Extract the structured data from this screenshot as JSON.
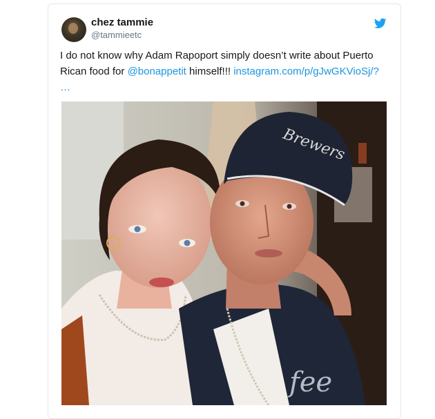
{
  "tweet": {
    "display_name": "chez tammie",
    "handle": "@tammieetc",
    "text_part1": "I do not know why Adam Rapoport simply doesn’t write about Puerto Rican food for ",
    "mention": "@bonappetit",
    "text_part2": " himself!!! ",
    "url": "instagram.com/p/gJwGKVioSj/?",
    "ellipsis": "…"
  },
  "colors": {
    "link": "#1b95e0",
    "twitter_blue": "#1da1f2",
    "border": "#e1e8ed"
  },
  "icons": {
    "brand": "twitter-bird-icon",
    "avatar": "avatar-photo"
  },
  "media": {
    "cap_text": "Brewers"
  }
}
